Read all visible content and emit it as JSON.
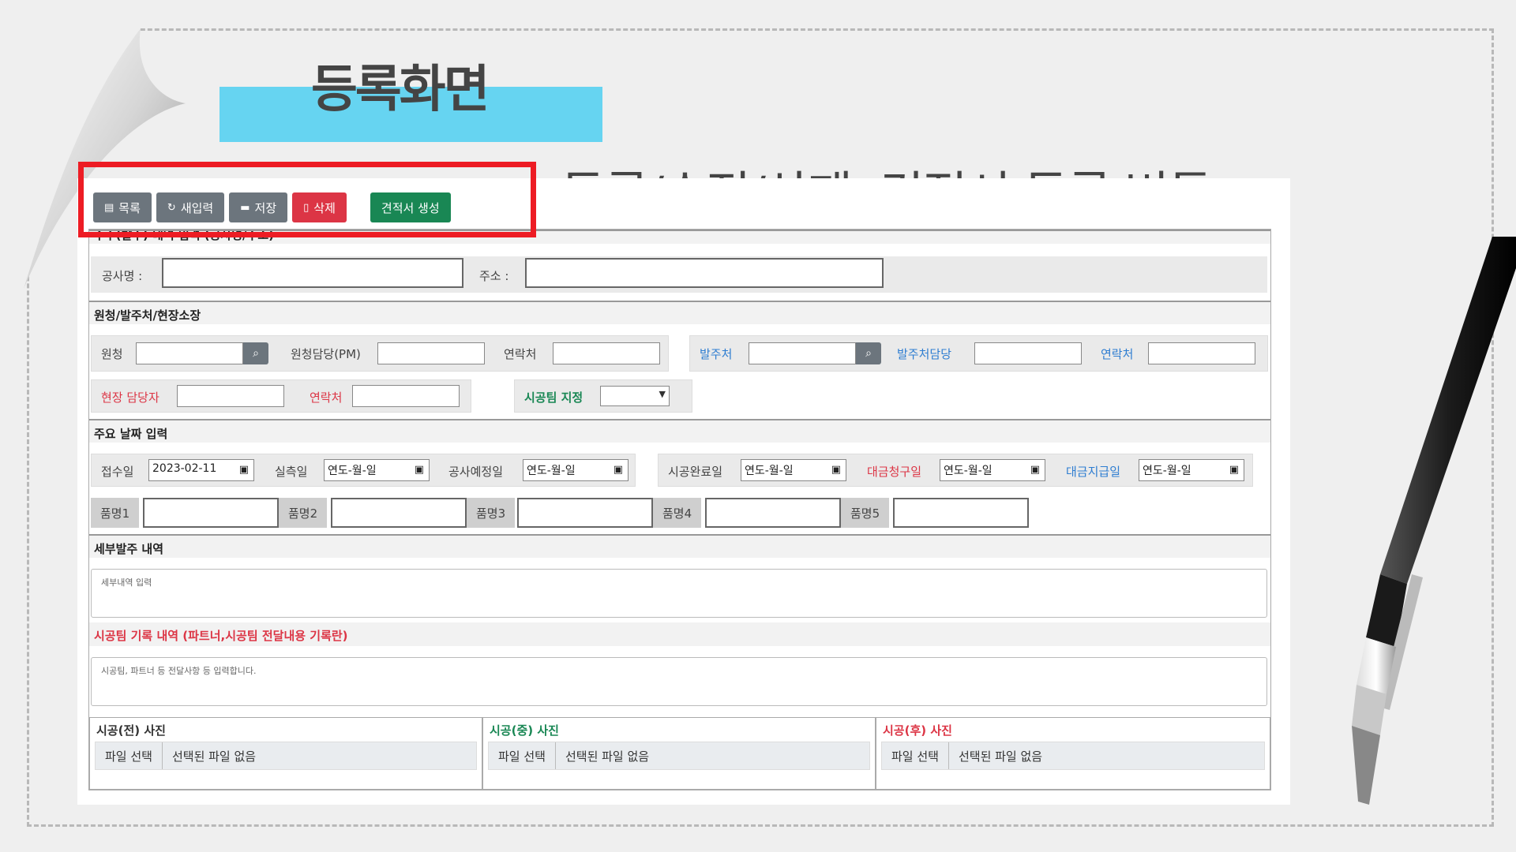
{
  "slide": {
    "title": "등록화면",
    "annotation": "등록/수정/삭제, 견적서 등록 버튼"
  },
  "toolbar": {
    "list_label": "목록",
    "reset_label": "새입력",
    "save_label": "저장",
    "delete_label": "삭제",
    "estimate_label": "견적서 생성"
  },
  "section_project": {
    "heading": "수주(발주) 내역 입력 (공사명/주소)",
    "name_label": "공사명 :",
    "address_label": "주소 :"
  },
  "section_client": {
    "heading": "원청/발주처/현장소장",
    "contractor_label": "원청",
    "pm_label": "원청담당(PM)",
    "contact1_label": "연락처",
    "orderer_label": "발주처",
    "orderer_manager_label": "발주처담당",
    "contact2_label": "연락처",
    "site_manager_label": "현장 담당자",
    "contact3_label": "연락처",
    "team_label": "시공팀 지정"
  },
  "section_dates": {
    "heading": "주요 날짜 입력",
    "receipt_label": "접수일",
    "receipt_value": "2023-02-11",
    "survey_label": "실측일",
    "planned_label": "공사예정일",
    "complete_label": "시공완료일",
    "billing_label": "대금청구일",
    "payment_label": "대금지급일",
    "date_placeholder": "연도-월-일",
    "product1": "품명1",
    "product2": "품명2",
    "product3": "품명3",
    "product4": "품명4",
    "product5": "품명5"
  },
  "section_detail": {
    "heading": "세부발주 내역",
    "placeholder": "세부내역 입력"
  },
  "section_team": {
    "heading": "시공팀 기록 내역 (파트너,시공팀 전달내용 기록란)",
    "placeholder": "시공팀, 파트너 등 전달사항 등 입력합니다."
  },
  "photos": {
    "before_title": "시공(전) 사진",
    "during_title": "시공(중) 사진",
    "after_title": "시공(후) 사진",
    "choose_label": "파일 선택",
    "none_label": "선택된 파일 없음"
  },
  "colors": {
    "title_bar": "#66d4f1",
    "highlight": "#ed1c24",
    "primary_gray": "#6c757d",
    "danger": "#dc3545",
    "success": "#198754",
    "link_blue": "#2e7dd1"
  }
}
